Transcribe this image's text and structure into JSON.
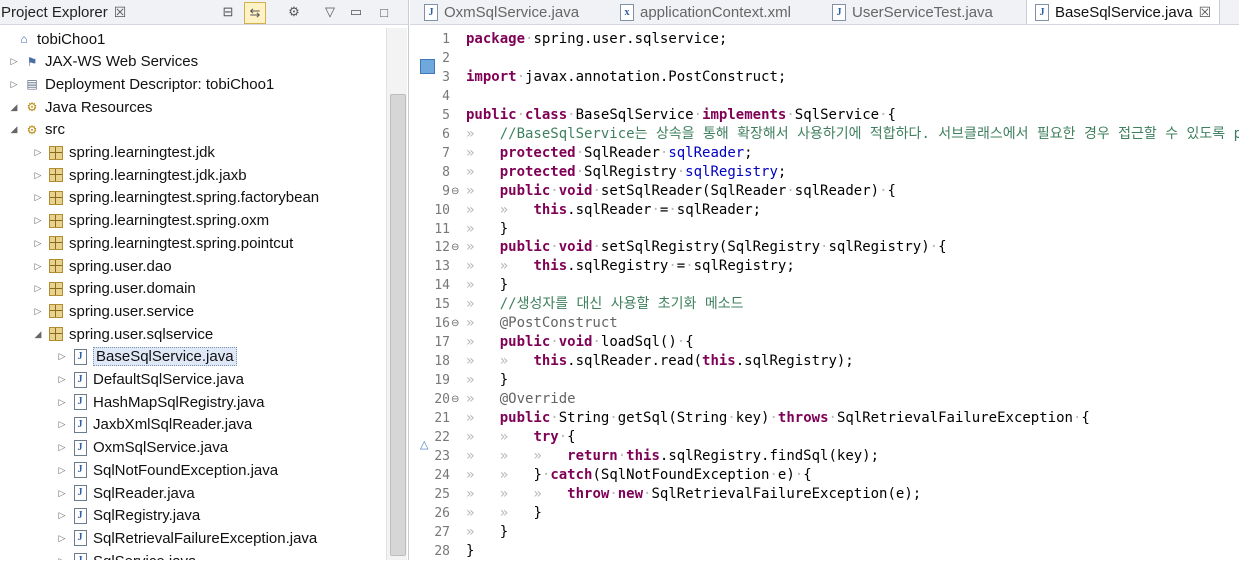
{
  "explorer": {
    "tab_label": "Project Explorer",
    "close_glyph": "☒",
    "tree": [
      {
        "label": "tobiChoo1",
        "depth": 0,
        "icon": "project-icon",
        "twisty": ""
      },
      {
        "label": "JAX-WS Web Services",
        "depth": 1,
        "icon": "webservice-icon",
        "twisty": "▷"
      },
      {
        "label": "Deployment Descriptor: tobiChoo1",
        "depth": 1,
        "icon": "descriptor-icon",
        "twisty": "▷"
      },
      {
        "label": "Java Resources",
        "depth": 1,
        "icon": "java-resources-icon",
        "twisty": "◢"
      },
      {
        "label": "src",
        "depth": 2,
        "icon": "source-folder-icon",
        "twisty": "◢"
      },
      {
        "label": "spring.learningtest.jdk",
        "depth": 3,
        "icon": "package-icon",
        "twisty": "▷"
      },
      {
        "label": "spring.learningtest.jdk.jaxb",
        "depth": 3,
        "icon": "package-icon",
        "twisty": "▷"
      },
      {
        "label": "spring.learningtest.spring.factorybean",
        "depth": 3,
        "icon": "package-icon",
        "twisty": "▷"
      },
      {
        "label": "spring.learningtest.spring.oxm",
        "depth": 3,
        "icon": "package-icon",
        "twisty": "▷"
      },
      {
        "label": "spring.learningtest.spring.pointcut",
        "depth": 3,
        "icon": "package-icon",
        "twisty": "▷"
      },
      {
        "label": "spring.user.dao",
        "depth": 3,
        "icon": "package-icon",
        "twisty": "▷"
      },
      {
        "label": "spring.user.domain",
        "depth": 3,
        "icon": "package-icon",
        "twisty": "▷"
      },
      {
        "label": "spring.user.service",
        "depth": 3,
        "icon": "package-icon",
        "twisty": "▷"
      },
      {
        "label": "spring.user.sqlservice",
        "depth": 3,
        "icon": "package-icon",
        "twisty": "◢"
      },
      {
        "label": "BaseSqlService.java",
        "depth": 4,
        "icon": "java-file-icon",
        "twisty": "▷",
        "selected": true
      },
      {
        "label": "DefaultSqlService.java",
        "depth": 4,
        "icon": "java-file-icon",
        "twisty": "▷"
      },
      {
        "label": "HashMapSqlRegistry.java",
        "depth": 4,
        "icon": "java-file-icon",
        "twisty": "▷"
      },
      {
        "label": "JaxbXmlSqlReader.java",
        "depth": 4,
        "icon": "java-file-icon",
        "twisty": "▷"
      },
      {
        "label": "OxmSqlService.java",
        "depth": 4,
        "icon": "java-file-icon",
        "twisty": "▷"
      },
      {
        "label": "SqlNotFoundException.java",
        "depth": 4,
        "icon": "java-file-icon",
        "twisty": "▷"
      },
      {
        "label": "SqlReader.java",
        "depth": 4,
        "icon": "java-file-icon",
        "twisty": "▷"
      },
      {
        "label": "SqlRegistry.java",
        "depth": 4,
        "icon": "java-file-icon",
        "twisty": "▷"
      },
      {
        "label": "SqlRetrievalFailureException.java",
        "depth": 4,
        "icon": "java-file-icon",
        "twisty": "▷"
      },
      {
        "label": "SqlService.java",
        "depth": 4,
        "icon": "java-file-icon",
        "twisty": "▷"
      }
    ]
  },
  "editor": {
    "tabs": [
      {
        "label": "OxmSqlService.java",
        "icon": "java-file-icon",
        "active": false
      },
      {
        "label": "applicationContext.xml",
        "icon": "xml-file-icon",
        "active": false
      },
      {
        "label": "UserServiceTest.java",
        "icon": "java-file-icon",
        "active": false
      },
      {
        "label": "BaseSqlService.java",
        "icon": "java-file-icon",
        "active": true
      }
    ],
    "tab_close_glyph": "☒",
    "lines": [
      {
        "n": "1",
        "fold": "",
        "tokens": [
          [
            "kw",
            "package"
          ],
          [
            "ws",
            "·"
          ],
          [
            "",
            "spring.user.sqlservice;"
          ]
        ]
      },
      {
        "n": "2",
        "fold": "",
        "tokens": []
      },
      {
        "n": "3",
        "fold": "",
        "tokens": [
          [
            "kw",
            "import"
          ],
          [
            "ws",
            "·"
          ],
          [
            "",
            "javax.annotation.PostConstruct;"
          ]
        ]
      },
      {
        "n": "4",
        "fold": "",
        "tokens": []
      },
      {
        "n": "5",
        "fold": "",
        "tokens": [
          [
            "kw",
            "public"
          ],
          [
            "ws",
            "·"
          ],
          [
            "kw",
            "class"
          ],
          [
            "ws",
            "·"
          ],
          [
            "",
            "BaseSqlService"
          ],
          [
            "ws",
            "·"
          ],
          [
            "kw",
            "implements"
          ],
          [
            "ws",
            "·"
          ],
          [
            "",
            "SqlService"
          ],
          [
            "ws",
            "·"
          ],
          [
            "",
            "{"
          ]
        ]
      },
      {
        "n": "6",
        "fold": "",
        "tokens": [
          [
            "ws",
            "»   "
          ],
          [
            "cm",
            "//BaseSqlService는 상속을 통해 확장해서 사용하기에 적합하다. 서브클래스에서 필요한 경우 접근할 수 있도록 protected 선언"
          ]
        ]
      },
      {
        "n": "7",
        "fold": "",
        "tokens": [
          [
            "ws",
            "»   "
          ],
          [
            "kw",
            "protected"
          ],
          [
            "ws",
            "·"
          ],
          [
            "",
            "SqlReader"
          ],
          [
            "ws",
            "·"
          ],
          [
            "fd",
            "sqlReader"
          ],
          [
            "",
            ";"
          ]
        ]
      },
      {
        "n": "8",
        "fold": "",
        "tokens": [
          [
            "ws",
            "»   "
          ],
          [
            "kw",
            "protected"
          ],
          [
            "ws",
            "·"
          ],
          [
            "",
            "SqlRegistry"
          ],
          [
            "ws",
            "·"
          ],
          [
            "fd",
            "sqlRegistry"
          ],
          [
            "",
            ";"
          ]
        ]
      },
      {
        "n": "9",
        "fold": "⊖",
        "tokens": [
          [
            "ws",
            "»   "
          ],
          [
            "kw",
            "public"
          ],
          [
            "ws",
            "·"
          ],
          [
            "kw",
            "void"
          ],
          [
            "ws",
            "·"
          ],
          [
            "",
            "setSqlReader(SqlReader"
          ],
          [
            "ws",
            "·"
          ],
          [
            "",
            "sqlReader)"
          ],
          [
            "ws",
            "·"
          ],
          [
            "",
            "{"
          ]
        ]
      },
      {
        "n": "10",
        "fold": "",
        "tokens": [
          [
            "ws",
            "»   »   "
          ],
          [
            "kw",
            "this"
          ],
          [
            "",
            ".sqlReader"
          ],
          [
            "ws",
            "·"
          ],
          [
            "",
            "="
          ],
          [
            "ws",
            "·"
          ],
          [
            "",
            "sqlReader;"
          ]
        ]
      },
      {
        "n": "11",
        "fold": "",
        "tokens": [
          [
            "ws",
            "»   "
          ],
          [
            "",
            "}"
          ]
        ]
      },
      {
        "n": "12",
        "fold": "⊖",
        "tokens": [
          [
            "ws",
            "»   "
          ],
          [
            "kw",
            "public"
          ],
          [
            "ws",
            "·"
          ],
          [
            "kw",
            "void"
          ],
          [
            "ws",
            "·"
          ],
          [
            "",
            "setSqlRegistry(SqlRegistry"
          ],
          [
            "ws",
            "·"
          ],
          [
            "",
            "sqlRegistry)"
          ],
          [
            "ws",
            "·"
          ],
          [
            "",
            "{"
          ]
        ]
      },
      {
        "n": "13",
        "fold": "",
        "tokens": [
          [
            "ws",
            "»   »   "
          ],
          [
            "kw",
            "this"
          ],
          [
            "",
            ".sqlRegistry"
          ],
          [
            "ws",
            "·"
          ],
          [
            "",
            "="
          ],
          [
            "ws",
            "·"
          ],
          [
            "",
            "sqlRegistry;"
          ]
        ]
      },
      {
        "n": "14",
        "fold": "",
        "tokens": [
          [
            "ws",
            "»   "
          ],
          [
            "",
            "}"
          ]
        ]
      },
      {
        "n": "15",
        "fold": "",
        "tokens": [
          [
            "ws",
            "»   "
          ],
          [
            "cm",
            "//생성자를 대신 사용할 초기화 메소드"
          ]
        ]
      },
      {
        "n": "16",
        "fold": "⊖",
        "tokens": [
          [
            "ws",
            "»   "
          ],
          [
            "an",
            "@PostConstruct"
          ]
        ]
      },
      {
        "n": "17",
        "fold": "",
        "tokens": [
          [
            "ws",
            "»   "
          ],
          [
            "kw",
            "public"
          ],
          [
            "ws",
            "·"
          ],
          [
            "kw",
            "void"
          ],
          [
            "ws",
            "·"
          ],
          [
            "",
            "loadSql()"
          ],
          [
            "ws",
            "·"
          ],
          [
            "",
            "{"
          ]
        ]
      },
      {
        "n": "18",
        "fold": "",
        "tokens": [
          [
            "ws",
            "»   »   "
          ],
          [
            "kw",
            "this"
          ],
          [
            "",
            ".sqlReader.read("
          ],
          [
            "kw",
            "this"
          ],
          [
            "",
            ".sqlRegistry);"
          ]
        ]
      },
      {
        "n": "19",
        "fold": "",
        "tokens": [
          [
            "ws",
            "»   "
          ],
          [
            "",
            "}"
          ]
        ]
      },
      {
        "n": "20",
        "fold": "⊖",
        "tokens": [
          [
            "ws",
            "»   "
          ],
          [
            "an",
            "@Override"
          ]
        ]
      },
      {
        "n": "21",
        "fold": "",
        "tokens": [
          [
            "ws",
            "»   "
          ],
          [
            "kw",
            "public"
          ],
          [
            "ws",
            "·"
          ],
          [
            "",
            "String"
          ],
          [
            "ws",
            "·"
          ],
          [
            "",
            "getSql(String"
          ],
          [
            "ws",
            "·"
          ],
          [
            "",
            "key)"
          ],
          [
            "ws",
            "·"
          ],
          [
            "kw",
            "throws"
          ],
          [
            "ws",
            "·"
          ],
          [
            "",
            "SqlRetrievalFailureException"
          ],
          [
            "ws",
            "·"
          ],
          [
            "",
            "{"
          ]
        ]
      },
      {
        "n": "22",
        "fold": "",
        "tokens": [
          [
            "ws",
            "»   »   "
          ],
          [
            "kw",
            "try"
          ],
          [
            "ws",
            "·"
          ],
          [
            "",
            "{"
          ]
        ]
      },
      {
        "n": "23",
        "fold": "",
        "tokens": [
          [
            "ws",
            "»   »   »   "
          ],
          [
            "kw",
            "return"
          ],
          [
            "ws",
            "·"
          ],
          [
            "kw",
            "this"
          ],
          [
            "",
            ".sqlRegistry.findSql(key);"
          ]
        ]
      },
      {
        "n": "24",
        "fold": "",
        "tokens": [
          [
            "ws",
            "»   »   "
          ],
          [
            "",
            "}"
          ],
          [
            "ws",
            "·"
          ],
          [
            "kw",
            "catch"
          ],
          [
            "",
            "(SqlNotFoundException"
          ],
          [
            "ws",
            "·"
          ],
          [
            "",
            "e)"
          ],
          [
            "ws",
            "·"
          ],
          [
            "",
            "{"
          ]
        ]
      },
      {
        "n": "25",
        "fold": "",
        "tokens": [
          [
            "ws",
            "»   »   »   "
          ],
          [
            "kw",
            "throw"
          ],
          [
            "ws",
            "·"
          ],
          [
            "kw",
            "new"
          ],
          [
            "ws",
            "·"
          ],
          [
            "",
            "SqlRetrievalFailureException(e);"
          ]
        ]
      },
      {
        "n": "26",
        "fold": "",
        "tokens": [
          [
            "ws",
            "»   »   "
          ],
          [
            "",
            "}"
          ]
        ]
      },
      {
        "n": "27",
        "fold": "",
        "tokens": [
          [
            "ws",
            "»   "
          ],
          [
            "",
            "}"
          ]
        ]
      },
      {
        "n": "28",
        "fold": "",
        "tokens": [
          [
            "",
            "}"
          ]
        ]
      }
    ]
  }
}
